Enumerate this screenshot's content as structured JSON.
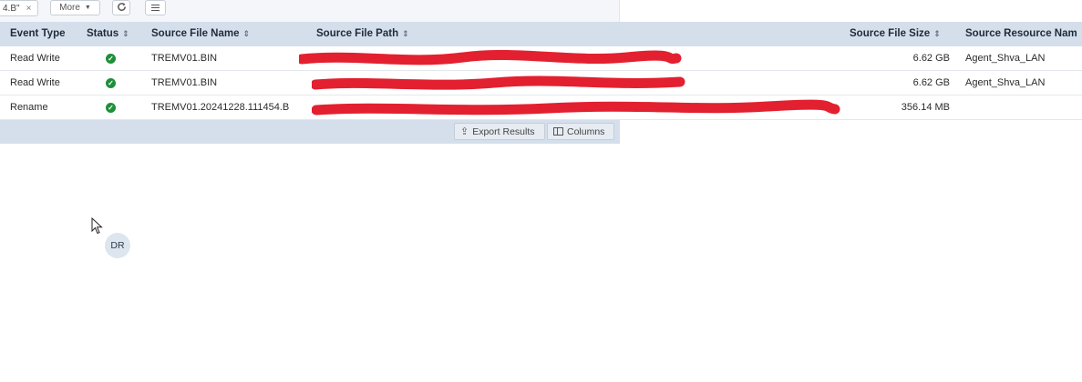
{
  "toolbar": {
    "filter_chip_text": "4.B\"",
    "filter_chip_close": "×",
    "more_label": "More",
    "more_caret": "▼",
    "refresh_icon": "refresh-icon",
    "refresh_glyph": "C",
    "menu_icon": "hamburger-icon"
  },
  "table": {
    "columns": [
      {
        "label": "Event Type",
        "sortable": false
      },
      {
        "label": "Status",
        "sortable": true
      },
      {
        "label": "Source File Name",
        "sortable": true
      },
      {
        "label": "Source File Path",
        "sortable": true
      },
      {
        "label": "Source File Size",
        "sortable": true
      },
      {
        "label": "Source Resource Nam",
        "sortable": false
      }
    ],
    "sort_glyph": "⇕",
    "rows": [
      {
        "event_type": "Read Write",
        "status": "success",
        "file_name": "TREMV01.BIN",
        "file_path": "[redacted]",
        "file_size": "6.62 GB",
        "resource": "Agent_Shva_LAN"
      },
      {
        "event_type": "Read Write",
        "status": "success",
        "file_name": "TREMV01.BIN",
        "file_path": "[redacted]",
        "file_size": "6.62 GB",
        "resource": "Agent_Shva_LAN"
      },
      {
        "event_type": "Rename",
        "status": "success",
        "file_name": "TREMV01.20241228.111454.B",
        "file_path": "[redacted]",
        "file_size": "356.14 MB",
        "resource": ""
      }
    ],
    "status_check_glyph": "✓",
    "status_color": "#1f8f3a",
    "redaction_color": "#e3202f"
  },
  "footer": {
    "export_label": "Export Results",
    "export_icon": "upload-icon",
    "export_glyph": "⇪",
    "columns_label": "Columns",
    "columns_icon": "columns-icon"
  },
  "avatar": {
    "initials": "DR"
  }
}
